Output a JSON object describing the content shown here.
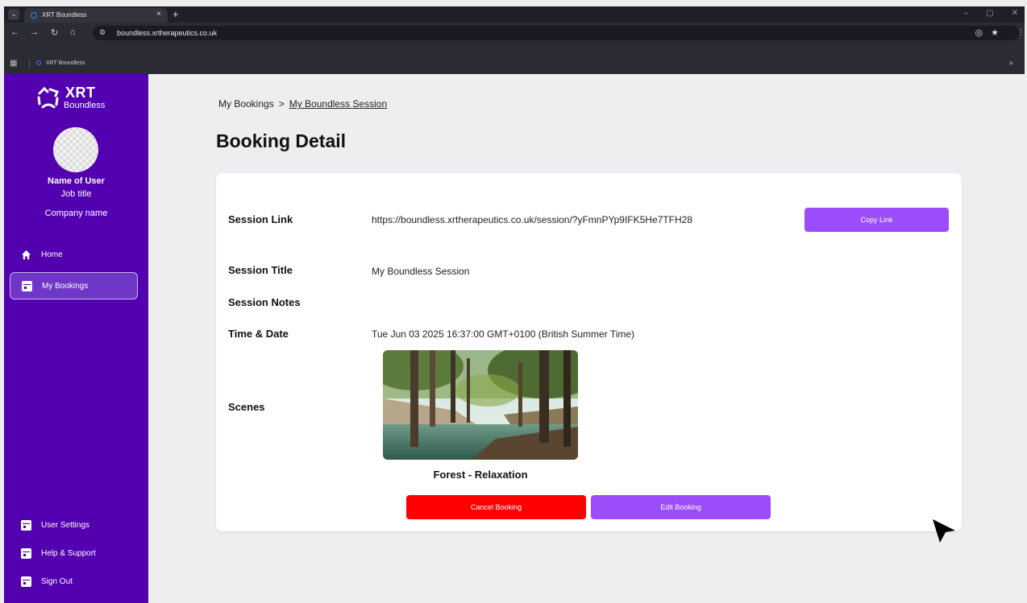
{
  "browser": {
    "tab_title": "XRT Boundless",
    "tab_close": "×",
    "new_tab": "+",
    "url": "boundless.xrtherapeutics.co.uk",
    "bookmark_label": "XRT Boundless",
    "bookmarks_overflow": "»"
  },
  "sidebar": {
    "logo_text": "XRT",
    "logo_subtext": "Boundless",
    "user": {
      "name": "Name of User",
      "job_title": "Job title",
      "company": "Company name"
    },
    "nav": {
      "home": "Home",
      "my_bookings": "My Bookings",
      "user_settings": "User Settings",
      "help_support": "Help & Support",
      "sign_out": "Sign Out"
    }
  },
  "main": {
    "breadcrumb": {
      "parent": "My Bookings",
      "separator": ">",
      "current": "My Boundless Session"
    },
    "title": "Booking Detail",
    "details": {
      "session_link_label": "Session Link",
      "session_link_value": "https://boundless.xrtherapeutics.co.uk/session/?yFmnPYp9IFK5He7TFH28",
      "copy_link_button": "Copy Link",
      "session_title_label": "Session Title",
      "session_title_value": "My Boundless Session",
      "session_notes_label": "Session Notes",
      "time_date_label": "Time & Date",
      "time_date_value": "Tue Jun 03 2025 16:37:00 GMT+0100 (British Summer Time)",
      "scenes_label": "Scenes",
      "scene_name": "Forest - Relaxation"
    },
    "actions": {
      "cancel": "Cancel Booking",
      "edit": "Edit Booking"
    }
  },
  "colors": {
    "sidebar": "#5300b0",
    "primary_button": "#9b4dfc",
    "danger_button": "#ff0000",
    "page_background": "#eeeef0"
  }
}
